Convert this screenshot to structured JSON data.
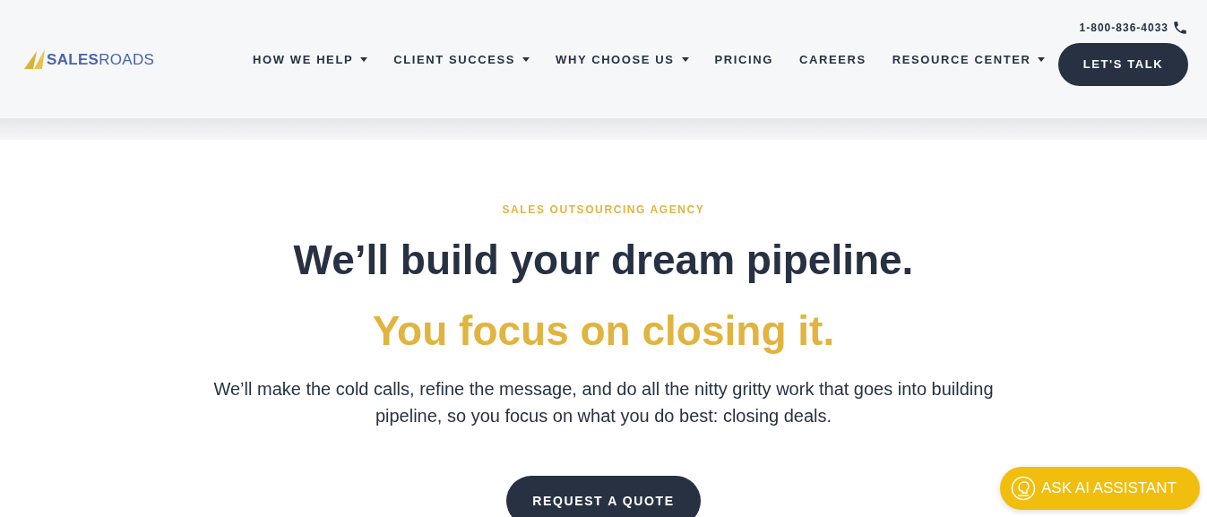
{
  "header": {
    "logo": "**SALES**ROADS",
    "phone": "1-800-836-4033",
    "cta": "LET'S TALK",
    "nav": [
      {
        "label": "HOW WE HELP",
        "dropdown": true
      },
      {
        "label": "CLIENT SUCCESS",
        "dropdown": true
      },
      {
        "label": "WHY CHOOSE US",
        "dropdown": true
      },
      {
        "label": "PRICING",
        "dropdown": false
      },
      {
        "label": "CAREERS",
        "dropdown": false
      },
      {
        "label": "RESOURCE CENTER",
        "dropdown": true
      }
    ]
  },
  "hero": {
    "eyebrow": "SALES OUTSOURCING AGENCY",
    "headline": "We’ll build your dream pipeline.",
    "subheadline": "You focus on closing it.",
    "body": "We’ll make the cold calls, refine the message, and do all the nitty gritty work that goes into building pipeline, so you focus on what you do best: closing deals.",
    "button": "REQUEST A QUOTE"
  },
  "assistant_button": "ASK AI ASSISTANT"
}
